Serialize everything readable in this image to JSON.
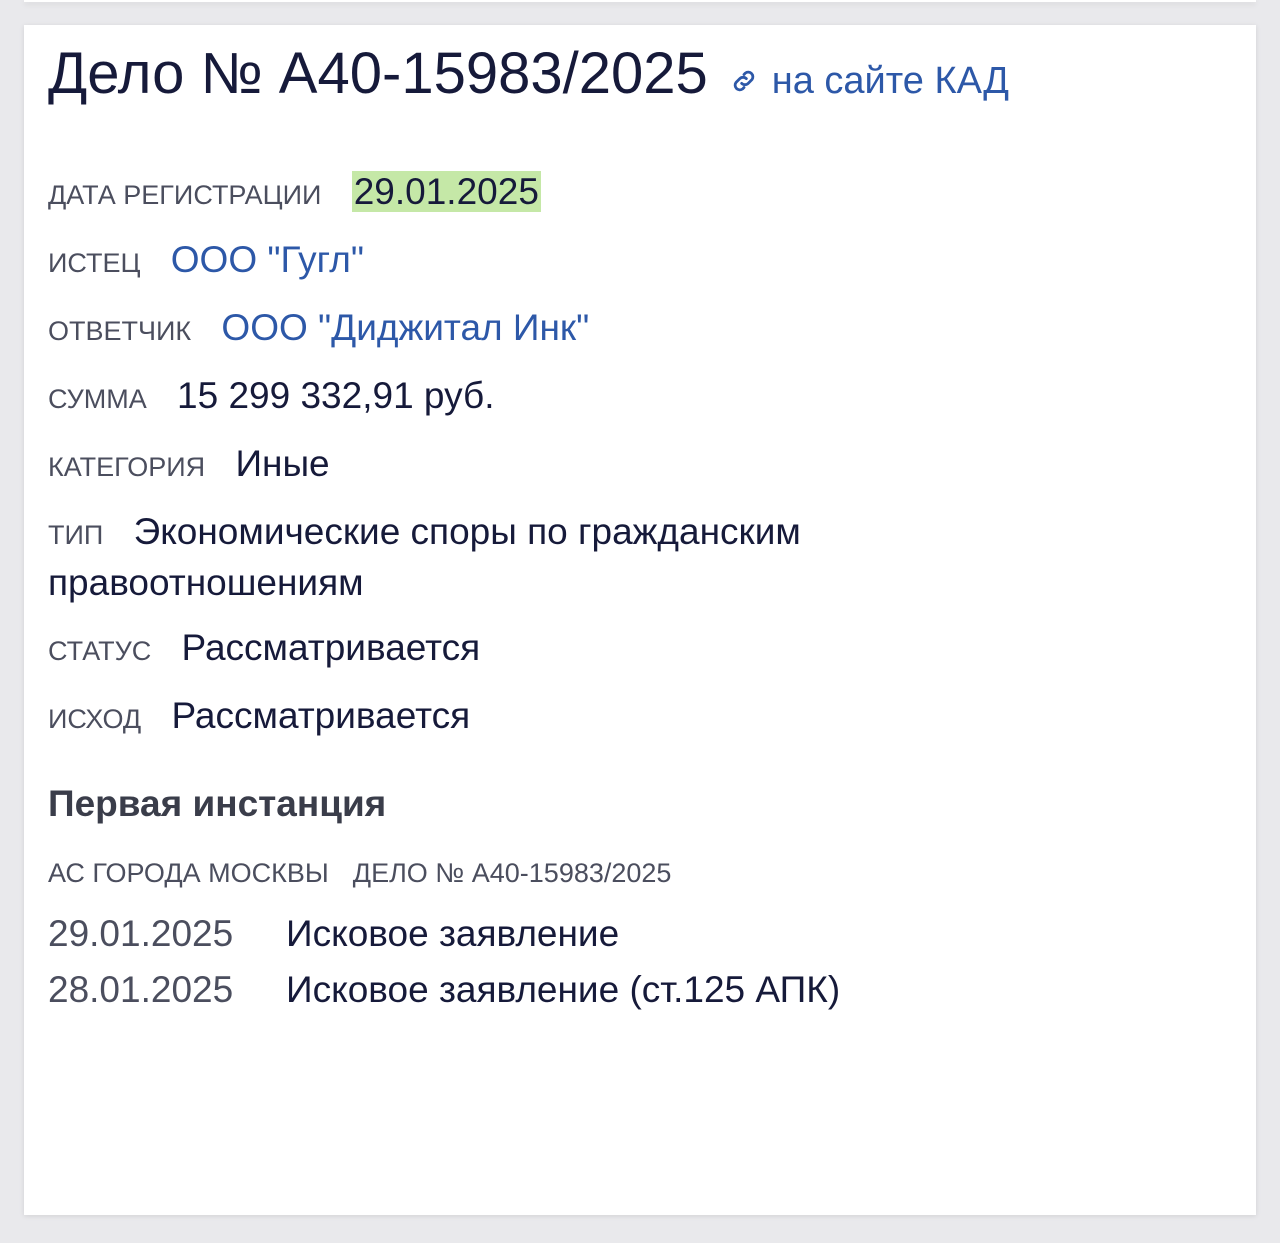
{
  "case": {
    "title": "Дело № А40-15983/2025",
    "kad_link": "на сайте КАД",
    "link_icon": "link-icon"
  },
  "fields": {
    "registration_date": {
      "label": "ДАТА РЕГИСТРАЦИИ",
      "value": "29.01.2025",
      "highlight_color": "#c5e8a7"
    },
    "plaintiff": {
      "label": "ИСТЕЦ",
      "value": "ООО \"Гугл\""
    },
    "defendant": {
      "label": "ОТВЕТЧИК",
      "value": "ООО \"Диджитал Инк\""
    },
    "amount": {
      "label": "СУММА",
      "value": "15 299 332,91 руб."
    },
    "category": {
      "label": "КАТЕГОРИЯ",
      "value": "Иные"
    },
    "type": {
      "label": "ТИП",
      "value": "Экономические споры по гражданским правоотношениям"
    },
    "status": {
      "label": "СТАТУС",
      "value": "Рассматривается"
    },
    "outcome": {
      "label": "ИСХОД",
      "value": "Рассматривается"
    }
  },
  "first_instance": {
    "title": "Первая инстанция",
    "court": "АС ГОРОДА МОСКВЫ",
    "case_ref": "ДЕЛО № А40-15983/2025",
    "events": [
      {
        "date": "29.01.2025",
        "description": "Исковое заявление"
      },
      {
        "date": "28.01.2025",
        "description": "Исковое заявление (ст.125 АПК)"
      }
    ]
  },
  "colors": {
    "link": "#2d58a8",
    "text": "#161a3a",
    "label": "#4b4e5e"
  }
}
